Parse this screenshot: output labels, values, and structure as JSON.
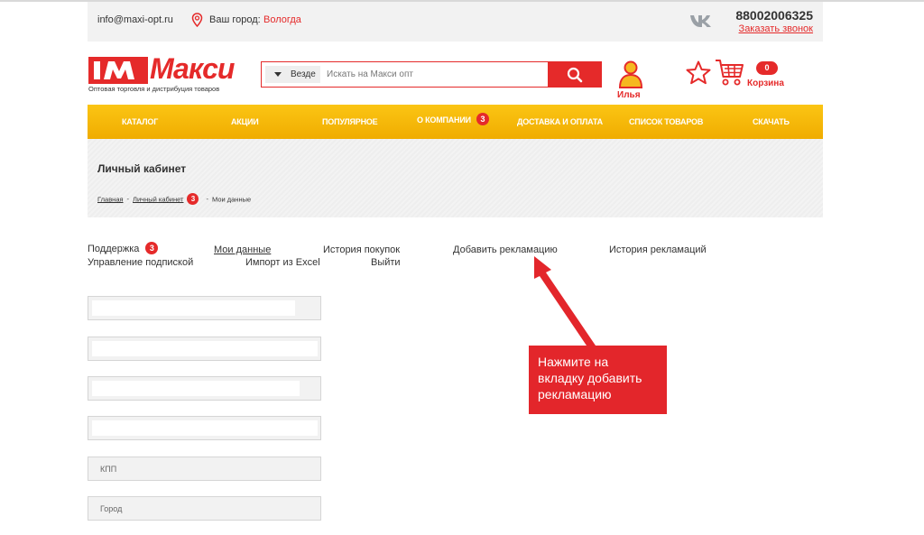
{
  "topbar": {
    "email": "info@maxi-opt.ru",
    "city_label": "Ваш город:",
    "city": "Вологда",
    "phone": "88002006325",
    "callback": "Заказать звонок"
  },
  "logo": {
    "text": "Макси",
    "subtitle": "Оптовая торговля и дистрибуция товаров"
  },
  "search": {
    "scope": "Везде",
    "placeholder": "Искать на Макси опт"
  },
  "user": {
    "name": "Илья"
  },
  "cart": {
    "count": "0",
    "label": "Корзина"
  },
  "menu": {
    "items": [
      {
        "label": "КАТАЛОГ"
      },
      {
        "label": "АКЦИИ"
      },
      {
        "label": "ПОПУЛЯРНОЕ"
      },
      {
        "label": "О КОМПАНИИ",
        "badge": "3"
      },
      {
        "label": "ДОСТАВКА И ОПЛАТА"
      },
      {
        "label": "СПИСОК ТОВАРОВ"
      },
      {
        "label": "СКАЧАТЬ"
      }
    ]
  },
  "hero": {
    "title": "Личный кабинет",
    "breadcrumbs": {
      "home": "Главная",
      "cabinet": "Личный кабинет",
      "badge": "3",
      "current": "Мои данные"
    }
  },
  "tabs": {
    "support": "Поддержка",
    "support_badge": "3",
    "my_data": "Мои данные",
    "history": "История покупок",
    "add_claim": "Добавить рекламацию",
    "claims_history": "История рекламаций",
    "subscription": "Управление подпиской",
    "import": "Импорт из Excel",
    "logout": "Выйти"
  },
  "form": {
    "kpp_placeholder": "КПП",
    "city_placeholder": "Город"
  },
  "callout": {
    "text": "Нажмите на вкладку добавить рекламацию"
  },
  "colors": {
    "brand_red": "#e52a2a",
    "menu_yellow": "#f8bb0a"
  }
}
